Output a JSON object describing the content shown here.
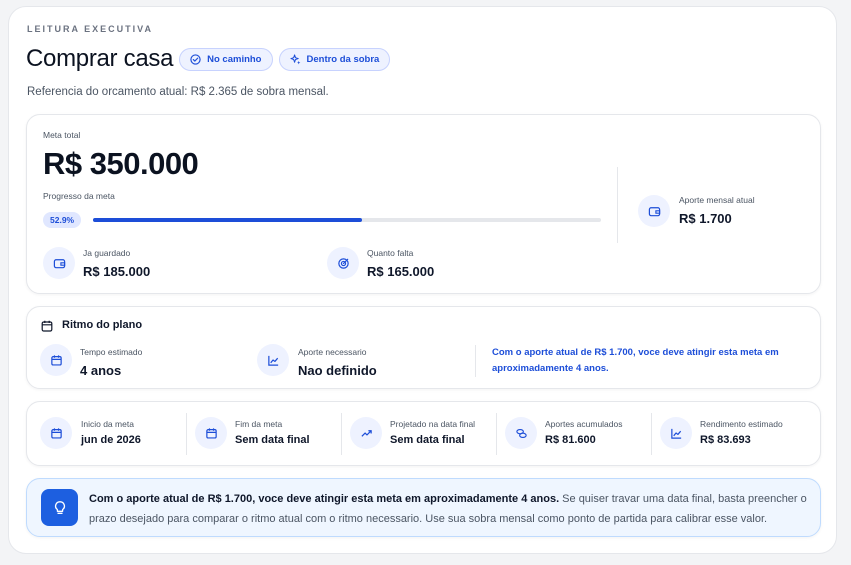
{
  "header": {
    "eyebrow": "LEITURA EXECUTIVA",
    "title": "Comprar casa",
    "badges": [
      "No caminho",
      "Dentro da sobra"
    ],
    "subtitle": "Referencia do orcamento atual: R$ 2.365 de sobra mensal."
  },
  "goal": {
    "total_label": "Meta total",
    "total_value": "R$ 350.000",
    "progress_label": "Progresso da meta",
    "progress_pct": "52.9%",
    "progress_fraction": 0.529,
    "saved_label": "Ja guardado",
    "saved_value": "R$ 185.000",
    "remaining_label": "Quanto falta",
    "remaining_value": "R$ 165.000",
    "monthly_label": "Aporte mensal atual",
    "monthly_value": "R$ 1.700"
  },
  "pace": {
    "title": "Ritmo do plano",
    "time_label": "Tempo estimado",
    "time_value": "4 anos",
    "needed_label": "Aporte necessario",
    "needed_value": "Nao definido",
    "message": "Com o aporte atual de R$ 1.700, voce deve atingir esta meta em aproximadamente 4 anos."
  },
  "stats": [
    {
      "label": "Inicio da meta",
      "value": "jun de 2026",
      "icon": "calendar-icon"
    },
    {
      "label": "Fim da meta",
      "value": "Sem data final",
      "icon": "calendar-icon"
    },
    {
      "label": "Projetado na data final",
      "value": "Sem data final",
      "icon": "trend-up-icon"
    },
    {
      "label": "Aportes acumulados",
      "value": "R$ 81.600",
      "icon": "coins-icon"
    },
    {
      "label": "Rendimento estimado",
      "value": "R$ 83.693",
      "icon": "chart-icon"
    }
  ],
  "note": {
    "bold": "Com o aporte atual de R$ 1.700, voce deve atingir esta meta em aproximadamente 4 anos.",
    "rest": " Se quiser travar uma data final, basta preencher o prazo desejado para comparar o ritmo atual com o ritmo necessario. Use sua sobra mensal como ponto de partida para calibrar esse valor."
  },
  "colors": {
    "accent": "#1d4ed8",
    "icon_bg": "#eef2ff"
  }
}
